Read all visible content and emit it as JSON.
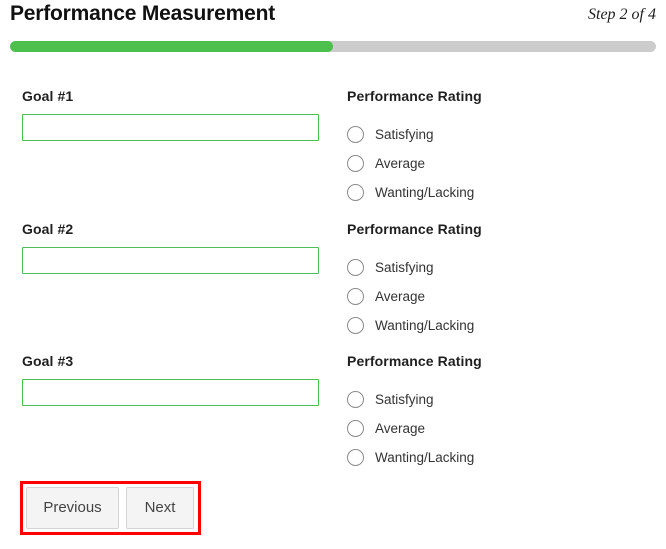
{
  "header": {
    "title": "Performance Measurement",
    "step_label": "Step 2 of 4"
  },
  "progress": {
    "percent": 50,
    "fill_color": "#4cbf4c",
    "track_color": "#cccccc"
  },
  "goals": [
    {
      "label": "Goal #1",
      "value": "",
      "placeholder": ""
    },
    {
      "label": "Goal #2",
      "value": "",
      "placeholder": ""
    },
    {
      "label": "Goal #3",
      "value": "",
      "placeholder": ""
    }
  ],
  "ratings": [
    {
      "title": "Performance Rating",
      "options": [
        {
          "label": "Satisfying",
          "selected": false
        },
        {
          "label": "Average",
          "selected": false
        },
        {
          "label": "Wanting/Lacking",
          "selected": false
        }
      ]
    },
    {
      "title": "Performance Rating",
      "options": [
        {
          "label": "Satisfying",
          "selected": false
        },
        {
          "label": "Average",
          "selected": false
        },
        {
          "label": "Wanting/Lacking",
          "selected": false
        }
      ]
    },
    {
      "title": "Performance Rating",
      "options": [
        {
          "label": "Satisfying",
          "selected": false
        },
        {
          "label": "Average",
          "selected": false
        },
        {
          "label": "Wanting/Lacking",
          "selected": false
        }
      ]
    }
  ],
  "footer": {
    "previous_label": "Previous",
    "next_label": "Next",
    "annotation_color": "#ff0000"
  },
  "colors": {
    "input_border": "#4cbf5c",
    "radio_border": "#8a8a8a",
    "button_face": "#f4f4f4"
  }
}
